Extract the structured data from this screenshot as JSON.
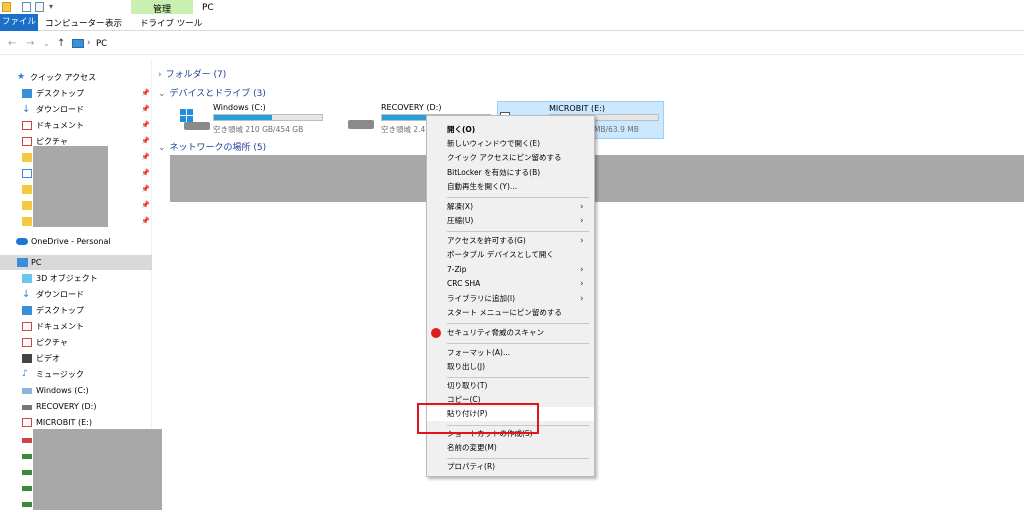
{
  "ribbon": {
    "manage": "管理",
    "title": "PC",
    "tabs": [
      "ファイル",
      "コンピューター",
      "表示",
      "ドライブ ツール"
    ]
  },
  "address": {
    "path": "PC"
  },
  "sidebar": {
    "quick_access": "クイック アクセス",
    "quick_items": [
      "デスクトップ",
      "ダウンロード",
      "ドキュメント",
      "ピクチャ"
    ],
    "onedrive": "OneDrive - Personal",
    "pc": "PC",
    "pc_items": [
      "3D オブジェクト",
      "ダウンロード",
      "デスクトップ",
      "ドキュメント",
      "ピクチャ",
      "ビデオ",
      "ミュージック",
      "Windows (C:)",
      "RECOVERY (D:)",
      "MICROBIT (E:)"
    ]
  },
  "main": {
    "folders": "フォルダー (7)",
    "devices": "デバイスとドライブ (3)",
    "network": "ネットワークの場所 (5)",
    "drives": [
      {
        "name": "Windows (C:)",
        "space": "空き領域 210 GB/454 GB",
        "used_fraction": 0.54
      },
      {
        "name": "RECOVERY (D:)",
        "space": "空き領域 2.4",
        "used_fraction": 0.9
      },
      {
        "name": "MICROBIT (E:)",
        "space": "MB/63.9 MB",
        "used_fraction": 0.0
      }
    ]
  },
  "context_menu": {
    "items": [
      {
        "label": "開く(O)"
      },
      {
        "label": "新しいウィンドウで開く(E)"
      },
      {
        "label": "クイック アクセスにピン留めする"
      },
      {
        "label": "BitLocker を有効にする(B)"
      },
      {
        "label": "自動再生を開く(Y)..."
      },
      {
        "label": "解凍(X)"
      },
      {
        "label": "圧縮(U)"
      },
      {
        "label": "アクセスを許可する(G)"
      },
      {
        "label": "ポータブル デバイスとして開く"
      },
      {
        "label": "7-Zip"
      },
      {
        "label": "CRC SHA"
      },
      {
        "label": "ライブラリに追加(I)"
      },
      {
        "label": "スタート メニューにピン留めする"
      },
      {
        "label": "セキュリティ脅威のスキャン"
      },
      {
        "label": "フォーマット(A)..."
      },
      {
        "label": "取り出し(J)"
      },
      {
        "label": "切り取り(T)"
      },
      {
        "label": "コピー(C)"
      },
      {
        "label": "貼り付け(P)"
      },
      {
        "label": "ショートカットの作成(S)"
      },
      {
        "label": "名前の変更(M)"
      },
      {
        "label": "プロパティ(R)"
      }
    ]
  },
  "colors": {
    "accent": "#1a6fc9",
    "highlight": "#e0141e",
    "bar": "#26a0da"
  }
}
